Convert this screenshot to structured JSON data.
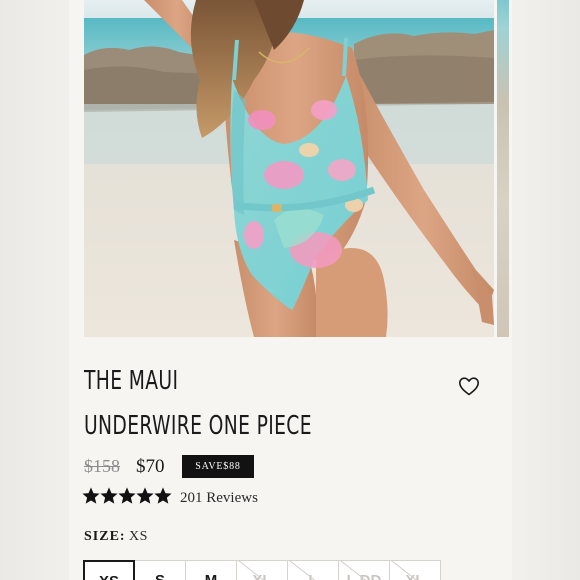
{
  "product": {
    "title_line1": "THE MAUI",
    "title_line2": "UNDERWIRE ONE PIECE",
    "original_price": "$158",
    "sale_price": "$70",
    "save_badge": "SAVE$88",
    "rating": 5,
    "rating_max": 5,
    "reviews": "201 Reviews"
  },
  "icons": {
    "wishlist": "heart-outline-icon",
    "star": "star-filled-icon"
  },
  "size": {
    "label": "SIZE:",
    "selected": "XS",
    "options": [
      {
        "label": "XS",
        "state": "selected"
      },
      {
        "label": "S",
        "state": "available"
      },
      {
        "label": "M",
        "state": "available"
      },
      {
        "label": "XL",
        "state": "unavailable"
      },
      {
        "label": "L",
        "state": "unavailable"
      },
      {
        "label": "L DD",
        "state": "unavailable"
      },
      {
        "label": "XL",
        "state": "unavailable"
      }
    ]
  },
  "colors": {
    "text": "#1a1a1a",
    "muted": "#8d8d8d",
    "badge_bg": "#121212",
    "badge_text": "#ffffff",
    "card_bg": "#f7f5f2"
  }
}
